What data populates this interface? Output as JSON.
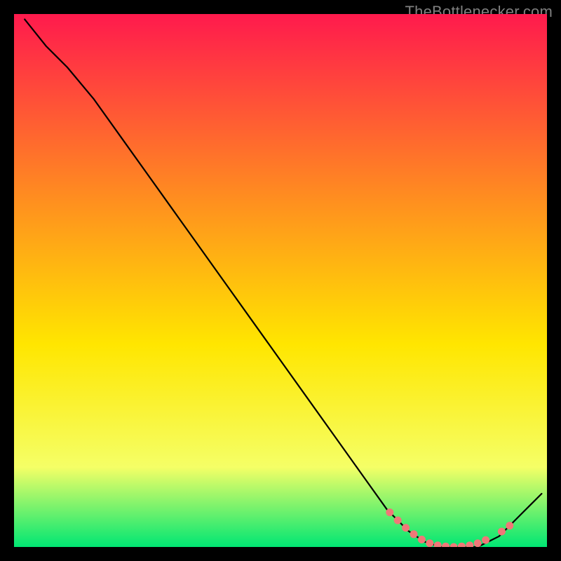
{
  "watermark": "TheBottlenecker.com",
  "chart_data": {
    "type": "line",
    "title": "",
    "xlabel": "",
    "ylabel": "",
    "xlim": [
      0,
      100
    ],
    "ylim": [
      0,
      100
    ],
    "grid": false,
    "background_gradient": [
      "#ff1a4d",
      "#ff8f1f",
      "#ffe600",
      "#f5ff66",
      "#00e673"
    ],
    "series": [
      {
        "name": "curve",
        "color": "#000000",
        "x": [
          2,
          6,
          8,
          10,
          15,
          20,
          25,
          30,
          35,
          40,
          45,
          50,
          55,
          60,
          65,
          70,
          74,
          77,
          80,
          83,
          85,
          87,
          89,
          91,
          93,
          95,
          97,
          99
        ],
        "values": [
          99,
          94,
          92,
          90,
          84,
          77,
          70,
          63,
          56,
          49,
          42,
          35,
          28,
          21,
          14,
          7,
          3,
          1,
          0,
          0,
          0,
          0,
          1,
          2,
          4,
          6,
          8,
          10
        ]
      }
    ],
    "markers": {
      "name": "dots",
      "color": "#f07878",
      "x": [
        70.5,
        72.0,
        73.5,
        75.0,
        76.5,
        78.0,
        79.5,
        81.0,
        82.5,
        84.0,
        85.5,
        87.0,
        88.5,
        91.5,
        93.0
      ],
      "values": [
        6.5,
        5.0,
        3.6,
        2.4,
        1.4,
        0.7,
        0.3,
        0.1,
        0.0,
        0.1,
        0.3,
        0.7,
        1.3,
        2.9,
        4.0
      ]
    }
  }
}
